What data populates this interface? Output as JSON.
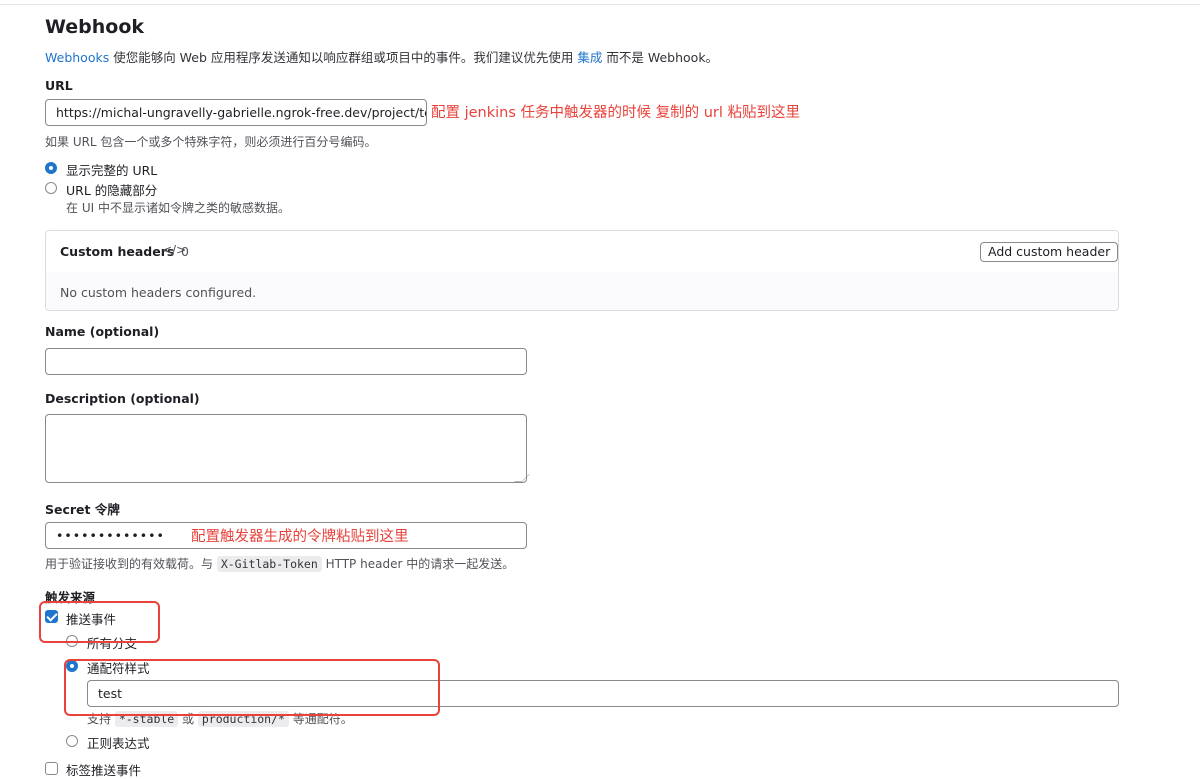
{
  "page": {
    "title": "Webhook",
    "intro": {
      "link1": "Webhooks",
      "text1": " 使您能够向 Web 应用程序发送通知以响应群组或项目中的事件。我们建议优先使用 ",
      "link2": "集成",
      "text2": " 而不是 Webhook。"
    }
  },
  "url": {
    "label": "URL",
    "value": "https://michal-ungravelly-gabrielle.ngrok-free.dev/project/test",
    "annotation": "配置 jenkins 任务中触发器的时候 复制的 url 粘贴到这里",
    "help": "如果 URL 包含一个或多个特殊字符，则必须进行百分号编码。",
    "options": [
      {
        "label": "显示完整的 URL",
        "checked": true
      },
      {
        "label": "URL 的隐藏部分",
        "checked": false
      }
    ],
    "mask_help": "在 UI 中不显示诸如令牌之类的敏感数据。"
  },
  "custom_headers": {
    "title": "Custom headers",
    "count_icon": "code-icon",
    "count": "0",
    "add_button": "Add custom header",
    "empty": "No custom headers configured."
  },
  "name": {
    "label": "Name (optional)",
    "value": ""
  },
  "description": {
    "label": "Description (optional)",
    "value": ""
  },
  "secret": {
    "label": "Secret 令牌",
    "value": "•••••••••••••",
    "annotation": "配置触发器生成的令牌粘贴到这里",
    "help_pre": "用于验证接收到的有效载荷。与 ",
    "help_code": "X-Gitlab-Token",
    "help_post": " HTTP header 中的请求一起发送。"
  },
  "triggers": {
    "label": "触发来源",
    "push_events": {
      "label": "推送事件",
      "checked": true
    },
    "branch_options": [
      {
        "label": "所有分支",
        "checked": false
      },
      {
        "label": "通配符样式",
        "checked": true
      },
      {
        "label": "正则表达式",
        "checked": false
      }
    ],
    "wildcard_value": "test",
    "wildcard_help_pre": "支持 ",
    "wildcard_code1": "*-stable",
    "wildcard_help_mid": " 或 ",
    "wildcard_code2": "production/*",
    "wildcard_help_post": " 等通配符。",
    "tag_push": {
      "label": "标签推送事件",
      "checked": false
    }
  },
  "colors": {
    "accent": "#1f75cb",
    "annotation": "#e8423b"
  }
}
